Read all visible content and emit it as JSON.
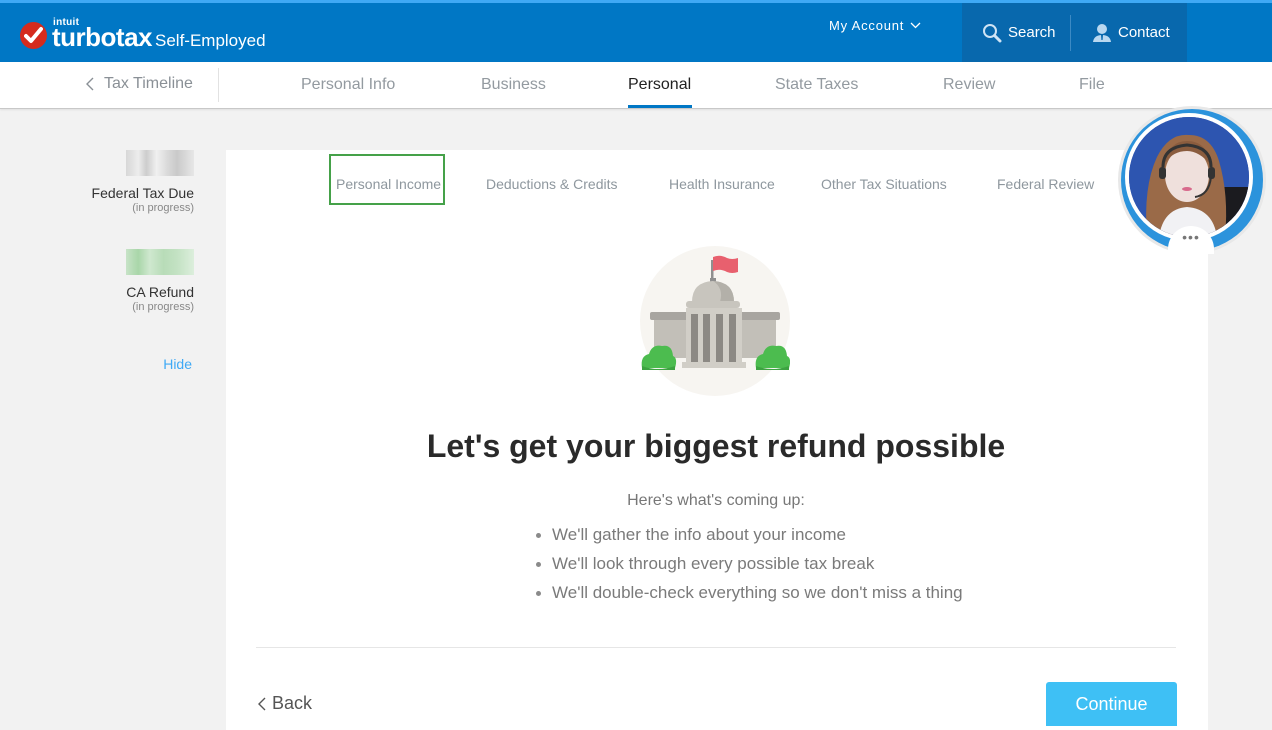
{
  "header": {
    "brand_parent": "intuit",
    "brand_name": "turbotax",
    "brand_dot": ".",
    "product": "Self-Employed",
    "my_account": "My Account",
    "search": "Search",
    "contact": "Contact",
    "colors": {
      "bar": "#0077c5",
      "tools_bg": "#0868ad",
      "logo_red": "#d52b1e"
    }
  },
  "stepnav": {
    "back_label": "Tax Timeline",
    "steps": [
      {
        "label": "Personal Info",
        "active": false
      },
      {
        "label": "Business",
        "active": false
      },
      {
        "label": "Personal",
        "active": true
      },
      {
        "label": "State Taxes",
        "active": false
      },
      {
        "label": "Review",
        "active": false
      },
      {
        "label": "File",
        "active": false
      }
    ]
  },
  "summary": {
    "federal": {
      "label": "Federal Tax Due",
      "status": "(in progress)"
    },
    "state": {
      "label": "CA Refund",
      "status": "(in progress)"
    },
    "hide_label": "Hide"
  },
  "subnav": {
    "tabs": [
      {
        "label": "Personal Income",
        "highlighted": true
      },
      {
        "label": "Deductions & Credits",
        "highlighted": false
      },
      {
        "label": "Health Insurance",
        "highlighted": false
      },
      {
        "label": "Other Tax Situations",
        "highlighted": false
      },
      {
        "label": "Federal Review",
        "highlighted": false
      }
    ],
    "highlight_color": "#45a149"
  },
  "main": {
    "illustration": "government-building-icon",
    "headline": "Let's get your biggest refund possible",
    "intro": "Here's what's coming up:",
    "bullets": [
      "We'll gather the info about your income",
      "We'll look through every possible tax break",
      "We'll double-check everything so we don't miss a thing"
    ],
    "back_label": "Back",
    "continue_label": "Continue",
    "continue_color": "#3ec0f5"
  },
  "video_chat": {
    "more_label": "•••"
  }
}
